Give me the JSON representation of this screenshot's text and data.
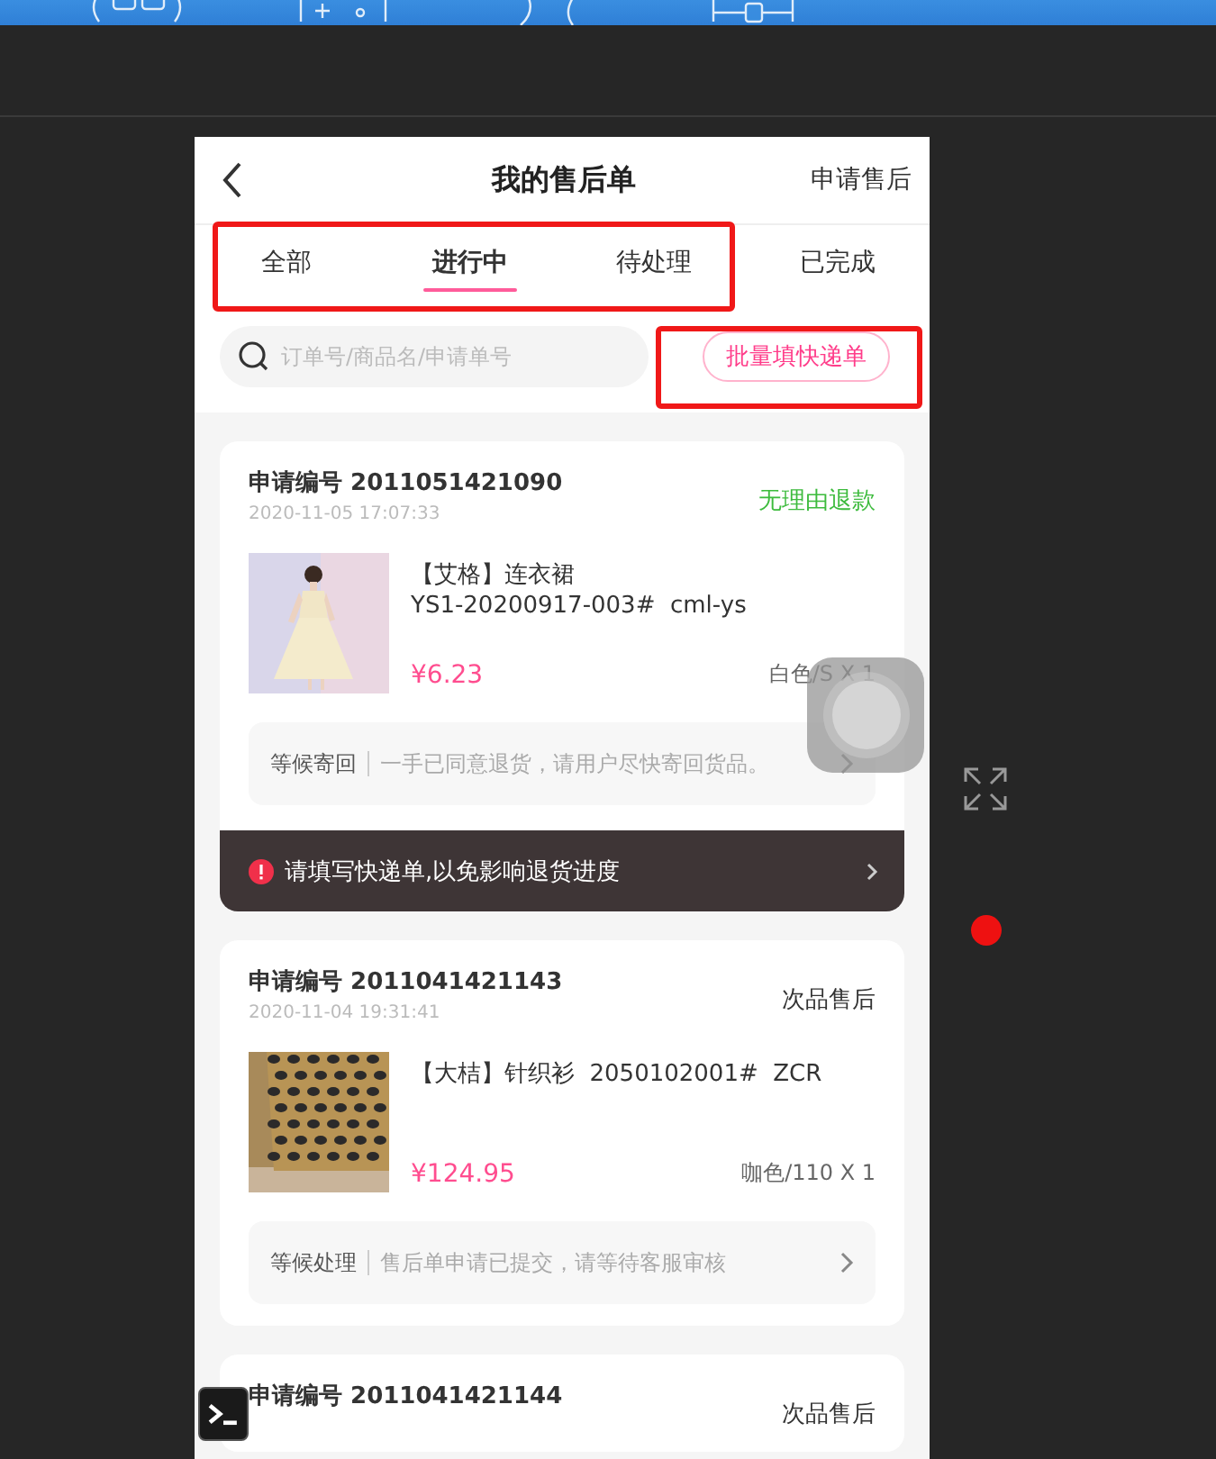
{
  "nav": {
    "title": "我的售后单",
    "action": "申请售后"
  },
  "tabs": [
    {
      "label": "全部",
      "selected": false
    },
    {
      "label": "进行中",
      "selected": true
    },
    {
      "label": "待处理",
      "selected": false
    },
    {
      "label": "已完成",
      "selected": false
    }
  ],
  "search": {
    "placeholder": "订单号/商品名/申请单号"
  },
  "batch_button": "批量填快递单",
  "orders": [
    {
      "number": "申请编号 2011051421090",
      "date": "2020-11-05 17:07:33",
      "type": "无理由退款",
      "color": "#3dbb3d",
      "title": "【艾格】连衣裙",
      "code": "YS1-20200917-003#  cml-ys",
      "price": "¥6.23",
      "spec": "白色/S X 1",
      "status": "等候寄回",
      "message": "一手已同意退货，请用户尽快寄回货品。",
      "notice": "请填写快递单,以免影响退货进度"
    },
    {
      "number": "申请编号 2011041421143",
      "date": "2020-11-04 19:31:41",
      "type": "次品售后",
      "color": "#333333",
      "title": "【大桔】针织衫  2050102001#  ZCR",
      "price": "¥124.95",
      "spec": "咖色/110 X 1",
      "status": "等候处理",
      "message": "售后单申请已提交，请等待客服审核"
    },
    {
      "number": "申请编号 2011041421144",
      "type": "次品售后",
      "color": "#333333"
    }
  ]
}
